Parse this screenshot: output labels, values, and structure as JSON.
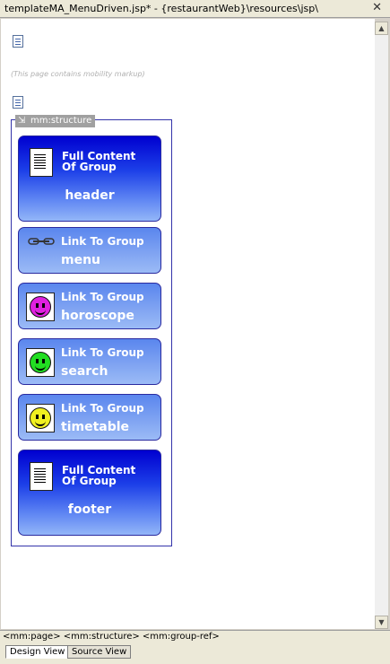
{
  "window": {
    "title": "templateMA_MenuDriven.jsp* - {restaurantWeb}\\resources\\jsp\\",
    "close_glyph": "✕"
  },
  "canvas": {
    "markup_note": "(This page contains mobility markup)",
    "structure_tag": "mm:structure",
    "blocks": [
      {
        "kind": "full",
        "label_line1": "Full Content",
        "label_line2": "Of Group",
        "name": "header",
        "icon": "document-icon"
      },
      {
        "kind": "link",
        "label": "Link To Group",
        "name": "menu",
        "icon": "link-chain-icon"
      },
      {
        "kind": "link",
        "label": "Link To Group",
        "name": "horoscope",
        "icon": "smiley-magenta-icon",
        "icon_color": "#e020e0"
      },
      {
        "kind": "link",
        "label": "Link To Group",
        "name": "search",
        "icon": "smiley-green-icon",
        "icon_color": "#22dd22"
      },
      {
        "kind": "link",
        "label": "Link To Group",
        "name": "timetable",
        "icon": "smiley-yellow-icon",
        "icon_color": "#f0f020"
      },
      {
        "kind": "full",
        "label_line1": "Full Content",
        "label_line2": "Of Group",
        "name": "footer",
        "icon": "document-icon"
      }
    ]
  },
  "status": {
    "breadcrumb": "<mm:page> <mm:structure> <mm:group-ref>"
  },
  "tabs": {
    "design": "Design View",
    "source": "Source View"
  }
}
